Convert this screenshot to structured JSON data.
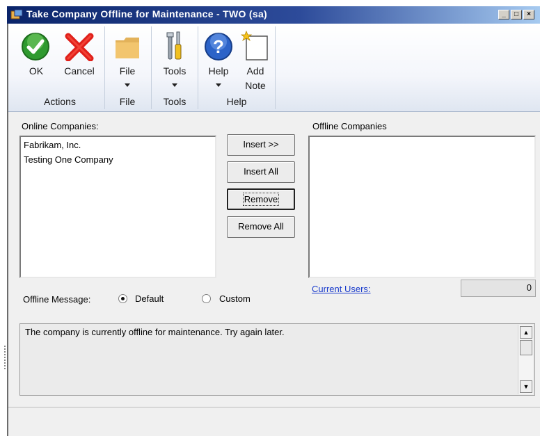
{
  "window": {
    "title": "Take Company Offline for Maintenance  -  TWO (sa)"
  },
  "ribbon": {
    "buttons": {
      "ok": "OK",
      "cancel": "Cancel",
      "file": "File",
      "tools": "Tools",
      "help": "Help",
      "add_note_line1": "Add",
      "add_note_line2": "Note"
    },
    "groups": {
      "actions": "Actions",
      "file": "File",
      "tools": "Tools",
      "help": "Help"
    }
  },
  "online": {
    "label": "Online Companies:",
    "items": [
      "Fabrikam, Inc.",
      "Testing One Company"
    ]
  },
  "offline": {
    "label": "Offline Companies",
    "items": []
  },
  "actions": {
    "insert": "Insert >>",
    "insert_all": "Insert All",
    "remove": "Remove",
    "remove_all": "Remove All"
  },
  "current_users": {
    "label": "Current Users:",
    "value": "0"
  },
  "offline_message": {
    "label": "Offline Message:",
    "default_label": "Default",
    "custom_label": "Custom",
    "selected": "Default",
    "text": "The company is currently offline for maintenance. Try again later."
  },
  "colors": {
    "ok_green": "#2f9a2f",
    "cancel_red": "#e0201a",
    "link_blue": "#1a3ccc",
    "titlebar": "#0a246a"
  },
  "icons": [
    "ok-check-icon",
    "cancel-x-icon",
    "folder-icon",
    "tools-icon",
    "help-question-icon",
    "add-note-icon"
  ]
}
